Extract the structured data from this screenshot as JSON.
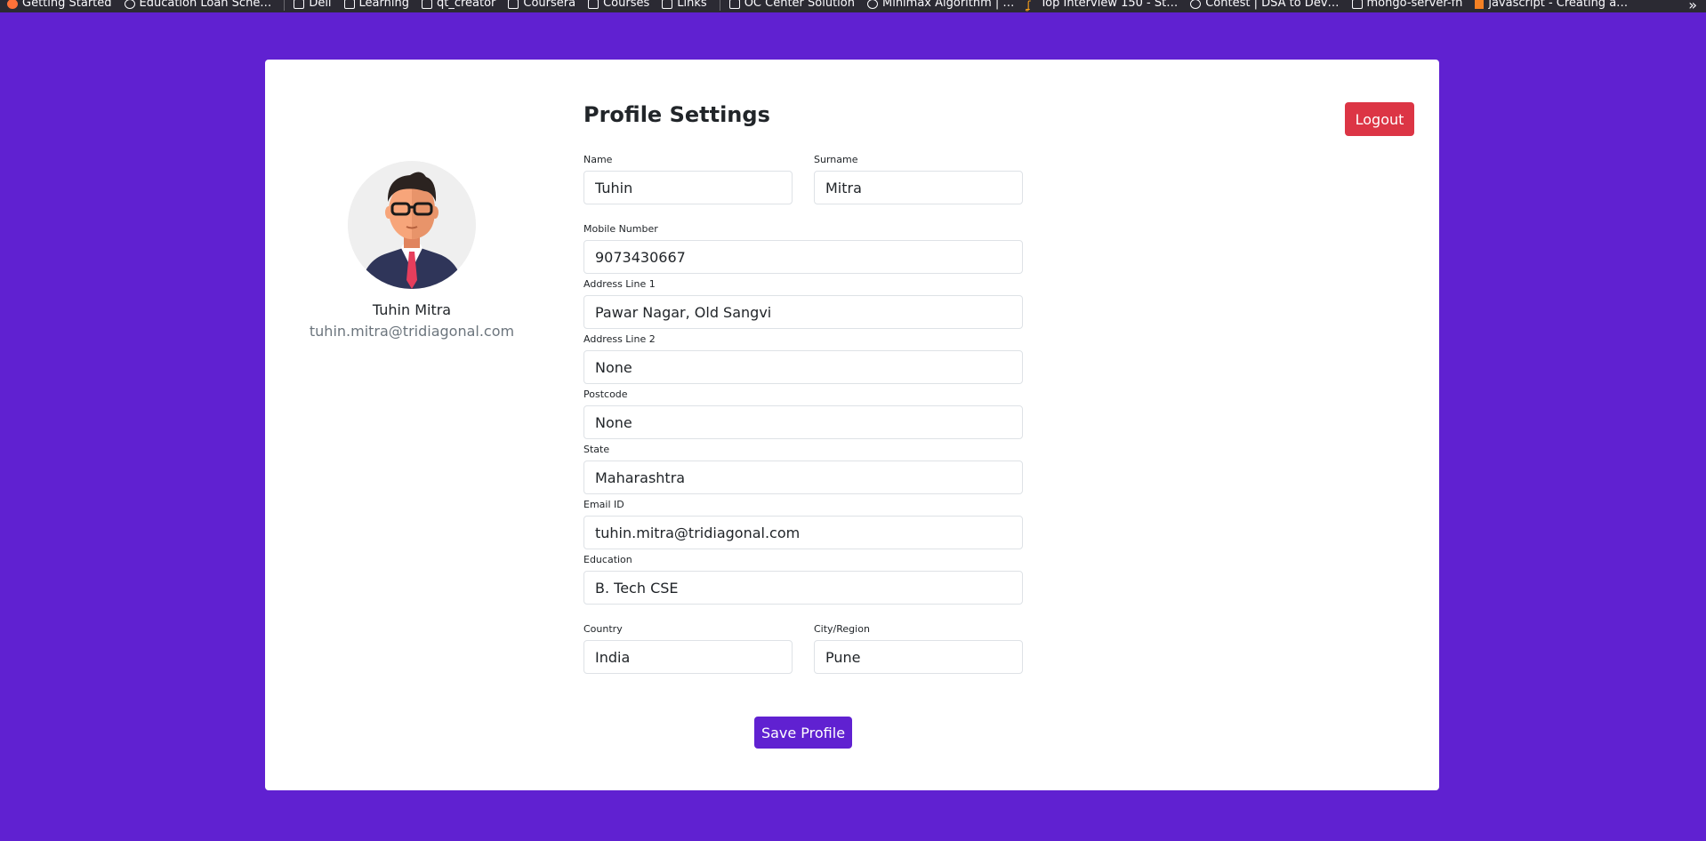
{
  "bookmarks": [
    {
      "label": "Getting Started",
      "icon": "firefox-icon"
    },
    {
      "label": "Education Loan Sche…",
      "icon": "globe-icon"
    },
    {
      "label": "Dell",
      "icon": "folder-icon"
    },
    {
      "label": "Learning",
      "icon": "folder-icon"
    },
    {
      "label": "qt_creator",
      "icon": "folder-icon"
    },
    {
      "label": "Coursera",
      "icon": "folder-icon"
    },
    {
      "label": "Courses",
      "icon": "folder-icon"
    },
    {
      "label": "Links",
      "icon": "folder-icon"
    },
    {
      "label": "OC Center Solution",
      "icon": "folder-icon"
    },
    {
      "label": "Minimax Algorithm | …",
      "icon": "globe-icon"
    },
    {
      "label": "Top Interview 150 - St…",
      "icon": "leetcode-icon"
    },
    {
      "label": "Contest | DSA to Dev…",
      "icon": "globe-icon"
    },
    {
      "label": "mongo-server-fn",
      "icon": "folder-icon"
    },
    {
      "label": "javascript - Creating a…",
      "icon": "stackoverflow-icon"
    }
  ],
  "bookmarks_overflow": "»",
  "profile": {
    "full_name": "Tuhin Mitra",
    "email": "tuhin.mitra@tridiagonal.com"
  },
  "page": {
    "title": "Profile Settings",
    "logout_label": "Logout",
    "save_label": "Save Profile"
  },
  "form": {
    "name": {
      "label": "Name",
      "value": "Tuhin"
    },
    "surname": {
      "label": "Surname",
      "value": "Mitra"
    },
    "mobile": {
      "label": "Mobile Number",
      "value": "9073430667"
    },
    "address1": {
      "label": "Address Line 1",
      "value": "Pawar Nagar, Old Sangvi"
    },
    "address2": {
      "label": "Address Line 2",
      "value": "None"
    },
    "postcode": {
      "label": "Postcode",
      "value": "None"
    },
    "state": {
      "label": "State",
      "value": "Maharashtra"
    },
    "email": {
      "label": "Email ID",
      "value": "tuhin.mitra@tridiagonal.com"
    },
    "education": {
      "label": "Education",
      "value": "B. Tech CSE"
    },
    "country": {
      "label": "Country",
      "value": "India"
    },
    "city": {
      "label": "City/Region",
      "value": "Pune"
    }
  },
  "colors": {
    "background": "#6021d1",
    "logout": "#dc3545",
    "save": "#6021d1",
    "muted_text": "#6c757d"
  }
}
